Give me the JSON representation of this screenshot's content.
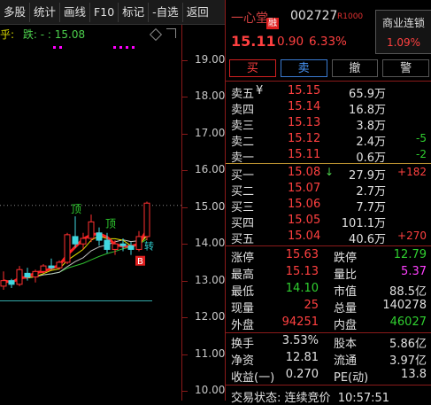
{
  "toolbar": {
    "items": [
      "多股",
      "统计",
      "画线",
      "F10",
      "标记",
      "-自选",
      "返回"
    ]
  },
  "legend": {
    "prefix": "乎:",
    "dash_label": "跌:",
    "value": "15.08"
  },
  "chart_data": {
    "type": "candlestick",
    "y_ticks": [
      "19.00",
      "18.00",
      "17.00",
      "16.00",
      "15.00",
      "14.00",
      "13.00",
      "12.00",
      "11.00",
      "10.00"
    ],
    "ylim": [
      9.9,
      19.4
    ],
    "annotations": [
      "顶",
      "顶",
      "B",
      "转"
    ],
    "candles": [
      {
        "o": 12.85,
        "h": 13.25,
        "l": 12.75,
        "c": 13.0
      },
      {
        "o": 13.0,
        "h": 13.05,
        "l": 12.8,
        "c": 12.9
      },
      {
        "o": 12.9,
        "h": 13.4,
        "l": 12.85,
        "c": 13.3
      },
      {
        "o": 13.2,
        "h": 13.35,
        "l": 13.0,
        "c": 13.1
      },
      {
        "o": 13.1,
        "h": 13.3,
        "l": 12.95,
        "c": 13.25
      },
      {
        "o": 13.25,
        "h": 13.45,
        "l": 13.2,
        "c": 13.4
      },
      {
        "o": 13.4,
        "h": 13.6,
        "l": 13.3,
        "c": 13.35
      },
      {
        "o": 13.35,
        "h": 13.55,
        "l": 13.3,
        "c": 13.5
      },
      {
        "o": 13.5,
        "h": 14.3,
        "l": 13.45,
        "c": 14.25
      },
      {
        "o": 14.2,
        "h": 14.75,
        "l": 13.9,
        "c": 14.0
      },
      {
        "o": 14.0,
        "h": 14.3,
        "l": 13.85,
        "c": 14.15
      },
      {
        "o": 14.15,
        "h": 14.8,
        "l": 14.05,
        "c": 14.6
      },
      {
        "o": 14.3,
        "h": 14.45,
        "l": 13.95,
        "c": 14.1
      },
      {
        "o": 14.1,
        "h": 14.3,
        "l": 13.75,
        "c": 13.85
      },
      {
        "o": 13.85,
        "h": 14.1,
        "l": 13.7,
        "c": 14.0
      },
      {
        "o": 14.0,
        "h": 14.15,
        "l": 13.8,
        "c": 13.95
      },
      {
        "o": 13.95,
        "h": 14.05,
        "l": 13.7,
        "c": 13.85
      },
      {
        "o": 13.85,
        "h": 14.35,
        "l": 13.8,
        "c": 14.2
      },
      {
        "o": 14.2,
        "h": 15.15,
        "l": 14.1,
        "c": 15.11
      }
    ],
    "hline_level": 12.45
  },
  "quote": {
    "name": "一心堂",
    "tag": "融",
    "code": "002727",
    "r_tag": "R1000",
    "price": "15.11",
    "change": "0.90",
    "pct": "6.33%",
    "concept_label": "商业连锁",
    "concept_pct": "1.09%"
  },
  "actions": [
    "买",
    "卖",
    "撤",
    "警"
  ],
  "orderbook": {
    "asks": [
      {
        "label": "卖五",
        "currency": "¥",
        "price": "15.15",
        "vol": "65.9万",
        "delta": ""
      },
      {
        "label": "卖四",
        "price": "15.14",
        "vol": "16.8万",
        "delta": ""
      },
      {
        "label": "卖三",
        "price": "15.13",
        "vol": "3.8万",
        "delta": ""
      },
      {
        "label": "卖二",
        "price": "15.12",
        "vol": "2.4万",
        "delta": "-5"
      },
      {
        "label": "卖一",
        "price": "15.11",
        "vol": "0.6万",
        "delta": "-2"
      }
    ],
    "bids": [
      {
        "label": "买一",
        "price": "15.08",
        "vol": "27.9万",
        "delta": "+182"
      },
      {
        "label": "买二",
        "price": "15.07",
        "vol": "2.7万",
        "delta": ""
      },
      {
        "label": "买三",
        "price": "15.06",
        "vol": "7.7万",
        "delta": ""
      },
      {
        "label": "买四",
        "price": "15.05",
        "vol": "101.1万",
        "delta": ""
      },
      {
        "label": "买五",
        "price": "15.04",
        "vol": "40.6万",
        "delta": "+270"
      }
    ]
  },
  "stats": [
    {
      "l1": "涨停",
      "v1": "15.63",
      "c1": "red",
      "l2": "跌停",
      "v2": "12.79",
      "c2": "green"
    },
    {
      "l1": "最高",
      "v1": "15.13",
      "c1": "red",
      "l2": "量比",
      "v2": "5.37",
      "c2": "magenta"
    },
    {
      "l1": "最低",
      "v1": "14.10",
      "c1": "green",
      "l2": "市值",
      "v2": "88.5亿",
      "c2": "white"
    },
    {
      "l1": "现量",
      "v1": "25",
      "c1": "red",
      "l2": "总量",
      "v2": "140278",
      "c2": "white"
    },
    {
      "l1": "外盘",
      "v1": "94251",
      "c1": "red",
      "l2": "内盘",
      "v2": "46027",
      "c2": "green"
    },
    {
      "l1": "换手",
      "v1": "3.53%",
      "c1": "white",
      "l2": "股本",
      "v2": "5.86亿",
      "c2": "white"
    },
    {
      "l1": "净资",
      "v1": "12.81",
      "c1": "white",
      "l2": "流通",
      "v2": "3.97亿",
      "c2": "white"
    },
    {
      "l1": "收益(一)",
      "v1": "0.270",
      "c1": "white",
      "l2": "PE(动)",
      "v2": "13.8",
      "c2": "white"
    }
  ],
  "status": {
    "label": "交易状态:",
    "value": "连续竞价",
    "time": "10:57:51"
  },
  "colors": {
    "up": "#ff4040",
    "down": "#30d030",
    "axis": "#8b1a1a"
  }
}
